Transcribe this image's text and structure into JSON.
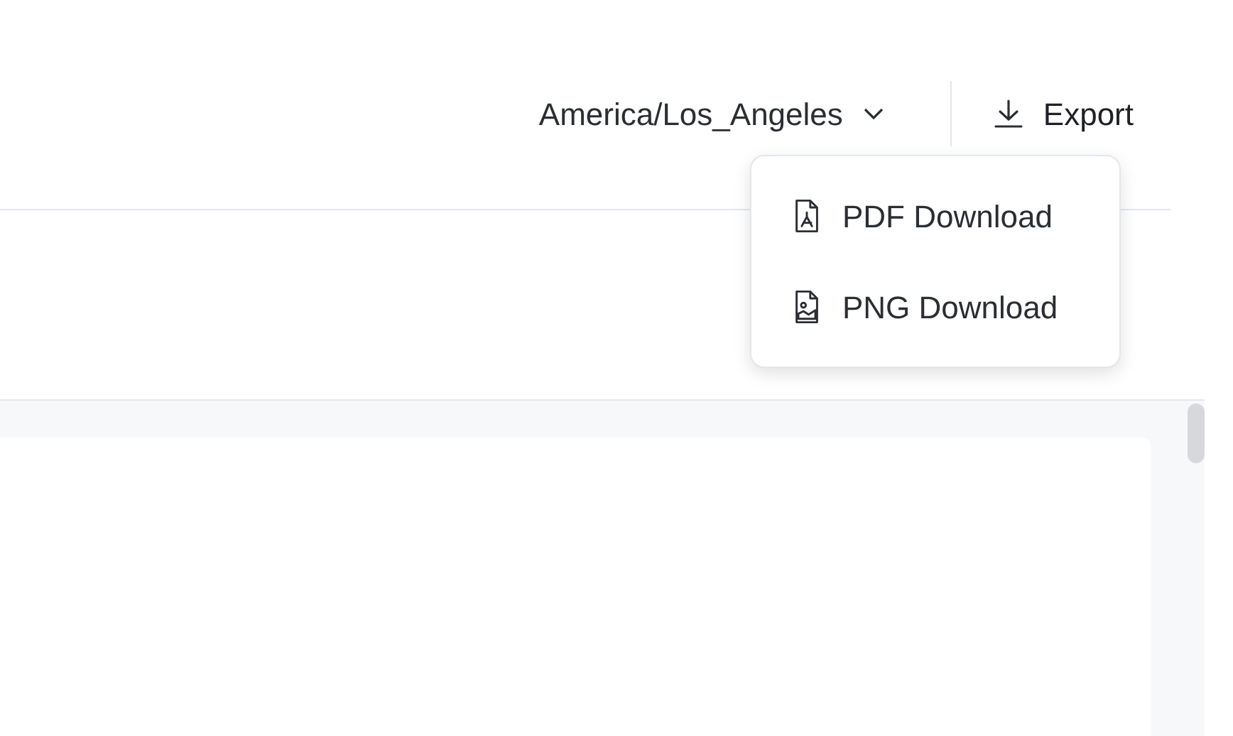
{
  "timezone": {
    "value": "America/Los_Angeles"
  },
  "export": {
    "label": "Export",
    "expanded": true
  },
  "export_menu": [
    {
      "kind": "pdf",
      "label": "PDF Download"
    },
    {
      "kind": "png",
      "label": "PNG Download"
    }
  ]
}
